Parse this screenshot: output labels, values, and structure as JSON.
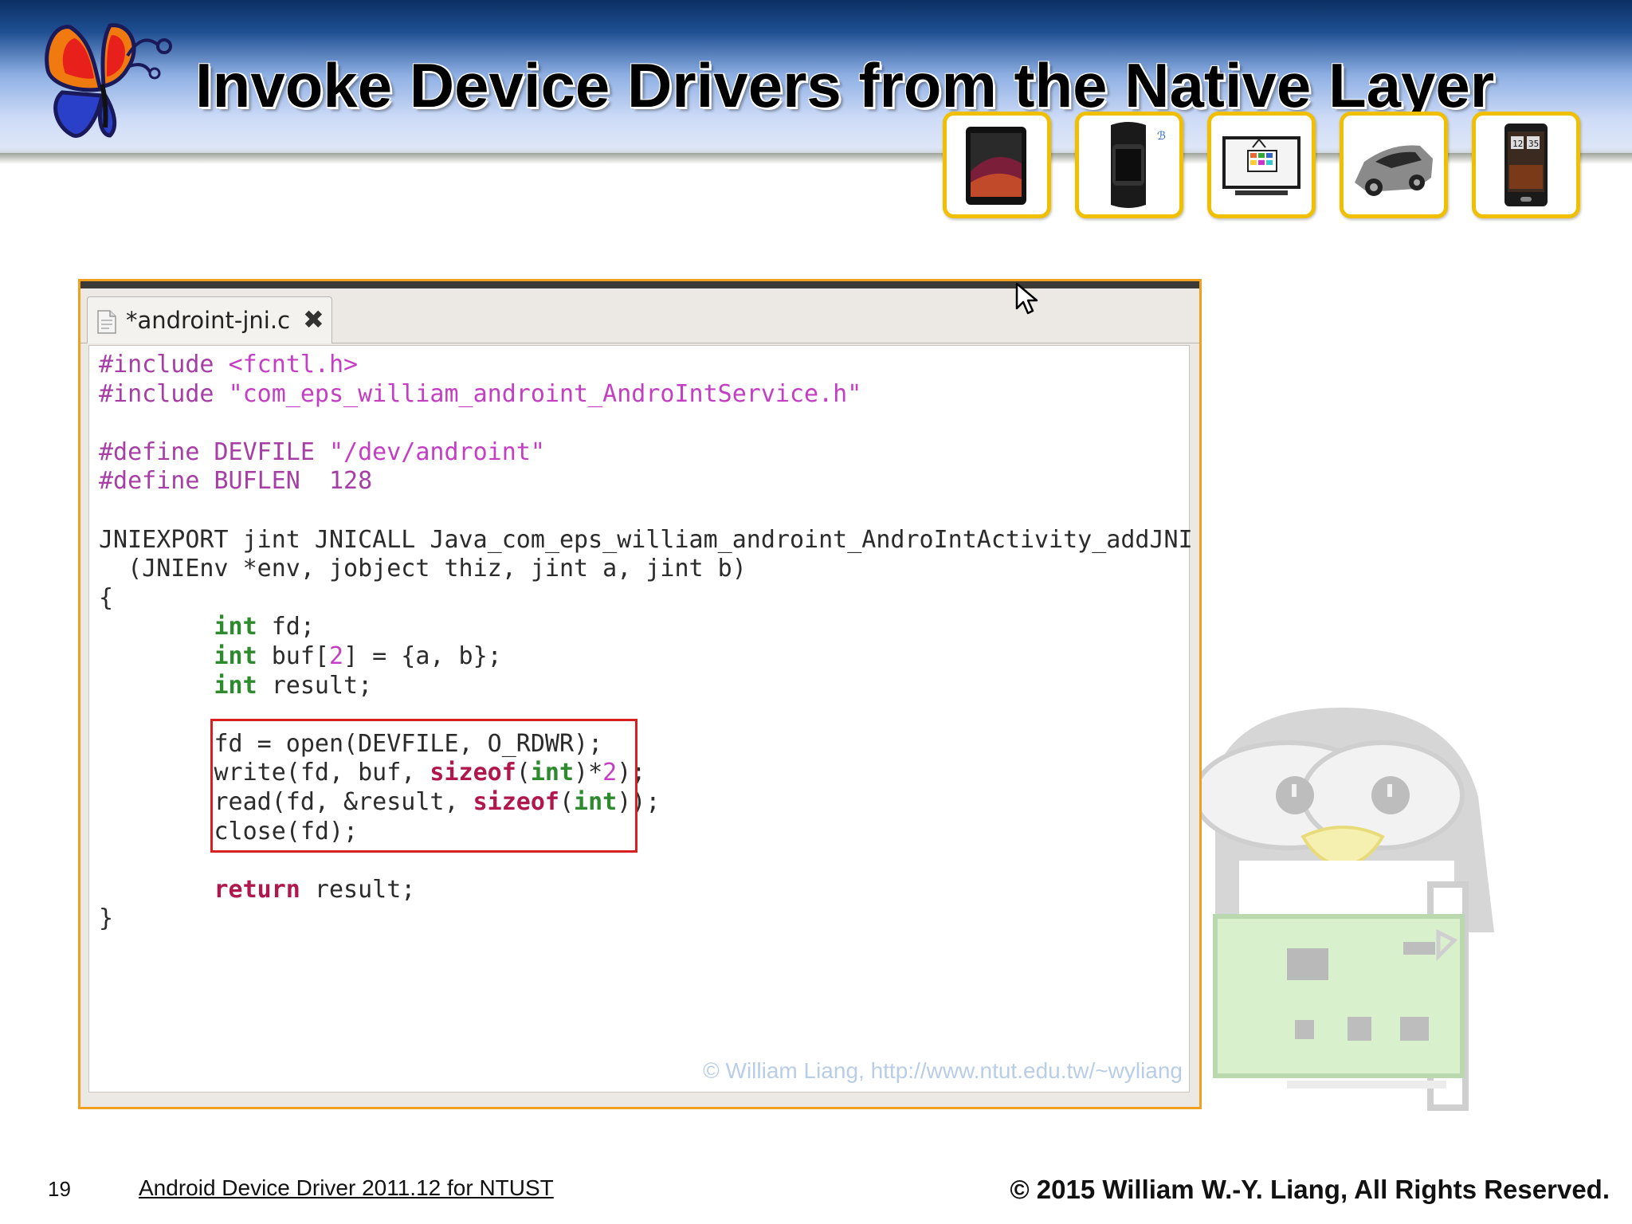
{
  "slide": {
    "title": "Invoke Device Drivers from the Native Layer",
    "page_number": "19",
    "course": "Android Device Driver 2011.12 for NTUST",
    "copyright": "©  2015  William W.-Y. Liang, All Rights Reserved."
  },
  "device_icons": [
    "tablet-icon",
    "smartwatch-icon",
    "tv-icon",
    "car-icon",
    "smartphone-icon"
  ],
  "editor": {
    "tab_label": "*androint-jni.c",
    "tab_close": "✖",
    "watermark": "© William Liang, http://www.ntut.edu.tw/~wyliang",
    "code_lines": [
      "#include <fcntl.h>",
      "#include \"com_eps_william_androint_AndroIntService.h\"",
      "",
      "#define DEVFILE \"/dev/androint\"",
      "#define BUFLEN  128",
      "",
      "JNIEXPORT jint JNICALL Java_com_eps_william_androint_AndroIntActivity_addJNI",
      "  (JNIEnv *env, jobject thiz, jint a, jint b)",
      "{",
      "        int fd;",
      "        int buf[2] = {a, b};",
      "        int result;",
      "",
      "        fd = open(DEVFILE, O_RDWR);",
      "        write(fd, buf, sizeof(int)*2);",
      "        read(fd, &result, sizeof(int));",
      "        close(fd);",
      "",
      "        return result;",
      "}"
    ]
  },
  "colors": {
    "banner_dark": "#0c2f63",
    "banner_light": "#cfdcf7",
    "device_border": "#f0c000",
    "editor_border": "#f0a020",
    "highlight_box": "#d92020",
    "preprocessor": "#a63ea6",
    "string": "#c33ec3",
    "type": "#2d8a2d",
    "keyword": "#b0174a"
  }
}
